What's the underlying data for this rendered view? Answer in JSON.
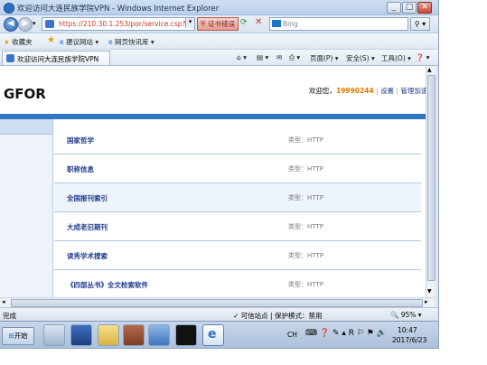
{
  "window": {
    "title": "欢迎访问大连民族学院VPN - Windows Internet Explorer",
    "min_glyph": "_",
    "max_glyph": "□",
    "close_glyph": "✕"
  },
  "address_bar": {
    "url": "https://210.30.1.253/por/service.csp?ty",
    "cert_label": "证书错误",
    "search_placeholder": "Bing"
  },
  "favorites_bar": {
    "favorites_label": "收藏夹",
    "items": [
      "建议网站 ▾",
      "网页快讯库 ▾"
    ]
  },
  "tab": {
    "title": "欢迎访问大连民族学院VPN"
  },
  "command_bar": {
    "page": "页面(P) ▾",
    "safety": "安全(S) ▾",
    "tools": "工具(O) ▾",
    "help": "❓ ▾"
  },
  "page": {
    "logo": "GFOR",
    "welcome": "欢迎您，",
    "username": "19990244",
    "settings": "设置",
    "admin": "管理加速",
    "resources": [
      {
        "name": "国家哲学",
        "type": "类型：HTTP"
      },
      {
        "name": "职称信息",
        "type": "类型：HTTP"
      },
      {
        "name": "全国报刊索引",
        "type": "类型：HTTP"
      },
      {
        "name": "大成老旧期刊",
        "type": "类型：HTTP"
      },
      {
        "name": "读秀学术搜索",
        "type": "类型：HTTP"
      },
      {
        "name": "《四部丛书》全文检索软件",
        "type": "类型：HTTP"
      }
    ]
  },
  "status_bar": {
    "text": "完成",
    "zone": "✓ 可信站点 | 保护模式：禁用",
    "zoom": "🔍 95% ▾"
  },
  "taskbar": {
    "start": "开始",
    "tray": "CH",
    "time": "10:47",
    "date": "2017/6/23"
  },
  "colors": {
    "accent_blue": "#2f77c5",
    "username_orange": "#e07a00",
    "link_blue": "#1f3b8a"
  }
}
